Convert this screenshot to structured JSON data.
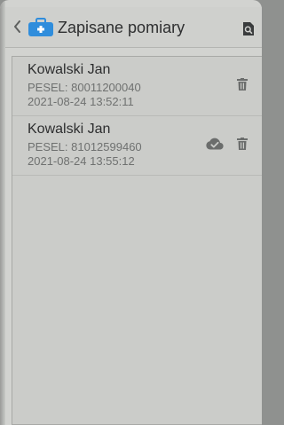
{
  "header": {
    "title": "Zapisane pomiary"
  },
  "records": [
    {
      "name": "Kowalski Jan",
      "pesel": "PESEL: 80011200040",
      "date": "2021-08-24 13:52:11",
      "synced": false
    },
    {
      "name": "Kowalski Jan",
      "pesel": "PESEL: 81012599460",
      "date": "2021-08-24 13:55:12",
      "synced": true
    }
  ],
  "colors": {
    "accent": "#2f8ddc",
    "icon": "#6b6d6c",
    "background": "#d2d3d0"
  },
  "icons": {
    "back": "chevron-left-icon",
    "app": "medical-case-icon",
    "search": "search-icon",
    "delete": "trash-icon",
    "cloud": "cloud-done-icon"
  }
}
